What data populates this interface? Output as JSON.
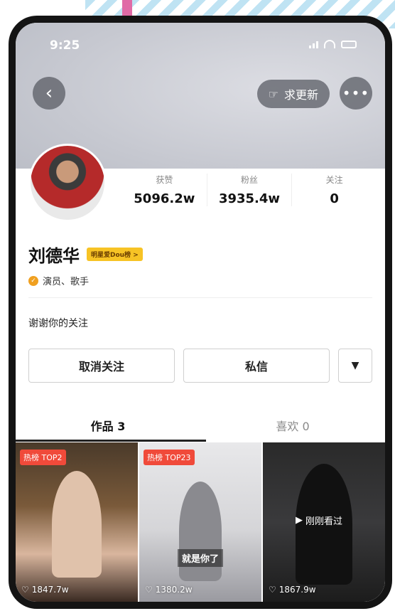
{
  "status": {
    "time": "9:25"
  },
  "header": {
    "update_label": "求更新"
  },
  "profile": {
    "stats": [
      {
        "label": "获赞",
        "value": "5096.2w"
      },
      {
        "label": "粉丝",
        "value": "3935.4w"
      },
      {
        "label": "关注",
        "value": "0"
      }
    ],
    "name": "刘德华",
    "rank_badge": "明星爱Dou榜 >",
    "verify_text": "演员、歌手",
    "bio": "谢谢你的关注"
  },
  "actions": {
    "unfollow": "取消关注",
    "message": "私信",
    "dropdown": "▼"
  },
  "tabs": [
    {
      "label": "作品 3"
    },
    {
      "label": "喜欢 0"
    }
  ],
  "videos": [
    {
      "tag": "热榜 TOP2",
      "likes": "1847.7w"
    },
    {
      "tag": "热榜 TOP23",
      "caption": "就是你了",
      "likes": "1380.2w"
    },
    {
      "recent": "刚刚看过",
      "likes": "1867.9w"
    }
  ],
  "icons": {
    "back": "chevron-left-icon",
    "update": "hand-point-icon",
    "more": "ellipsis-icon",
    "verify": "check-badge-icon",
    "heart": "heart-outline-icon",
    "play": "play-icon"
  }
}
